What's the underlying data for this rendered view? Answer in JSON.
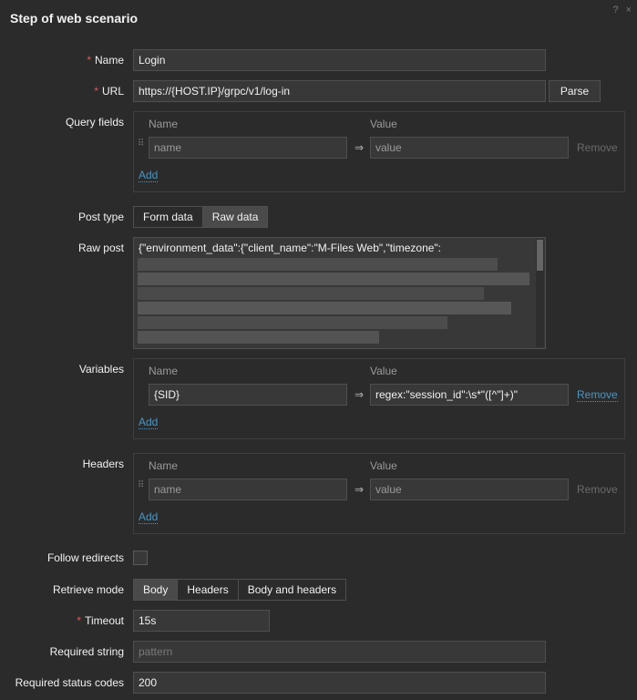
{
  "dialog": {
    "title": "Step of web scenario",
    "help_icon": "?",
    "close_icon": "×"
  },
  "name": {
    "label": "Name",
    "value": "Login"
  },
  "url": {
    "label": "URL",
    "value": "https://{HOST.IP}/grpc/v1/log-in",
    "parse_label": "Parse"
  },
  "query_fields": {
    "label": "Query fields",
    "col_name": "Name",
    "col_value": "Value",
    "rows": [
      {
        "name_placeholder": "name",
        "value_placeholder": "value",
        "remove_label": "Remove"
      }
    ],
    "add_label": "Add"
  },
  "post_type": {
    "label": "Post type",
    "options": [
      "Form data",
      "Raw data"
    ],
    "selected": "Raw data"
  },
  "raw_post": {
    "label": "Raw post",
    "first_line": "{\"environment_data\":{\"client_name\":\"M-Files Web\",\"timezone\":"
  },
  "variables": {
    "label": "Variables",
    "col_name": "Name",
    "col_value": "Value",
    "rows": [
      {
        "name": "{SID}",
        "value": "regex:\"session_id\":\\s*\"([^\"]+)\"",
        "remove_label": "Remove"
      }
    ],
    "add_label": "Add"
  },
  "headers": {
    "label": "Headers",
    "col_name": "Name",
    "col_value": "Value",
    "rows": [
      {
        "name_placeholder": "name",
        "value_placeholder": "value",
        "remove_label": "Remove"
      }
    ],
    "add_label": "Add"
  },
  "follow_redirects": {
    "label": "Follow redirects",
    "checked": false
  },
  "retrieve_mode": {
    "label": "Retrieve mode",
    "options": [
      "Body",
      "Headers",
      "Body and headers"
    ],
    "selected": "Body"
  },
  "timeout": {
    "label": "Timeout",
    "value": "15s"
  },
  "required_string": {
    "label": "Required string",
    "placeholder": "pattern"
  },
  "required_status_codes": {
    "label": "Required status codes",
    "value": "200"
  },
  "colors": {
    "background": "#2b2b2b",
    "input": "#383838",
    "link": "#4796c4",
    "required": "#e45959"
  }
}
